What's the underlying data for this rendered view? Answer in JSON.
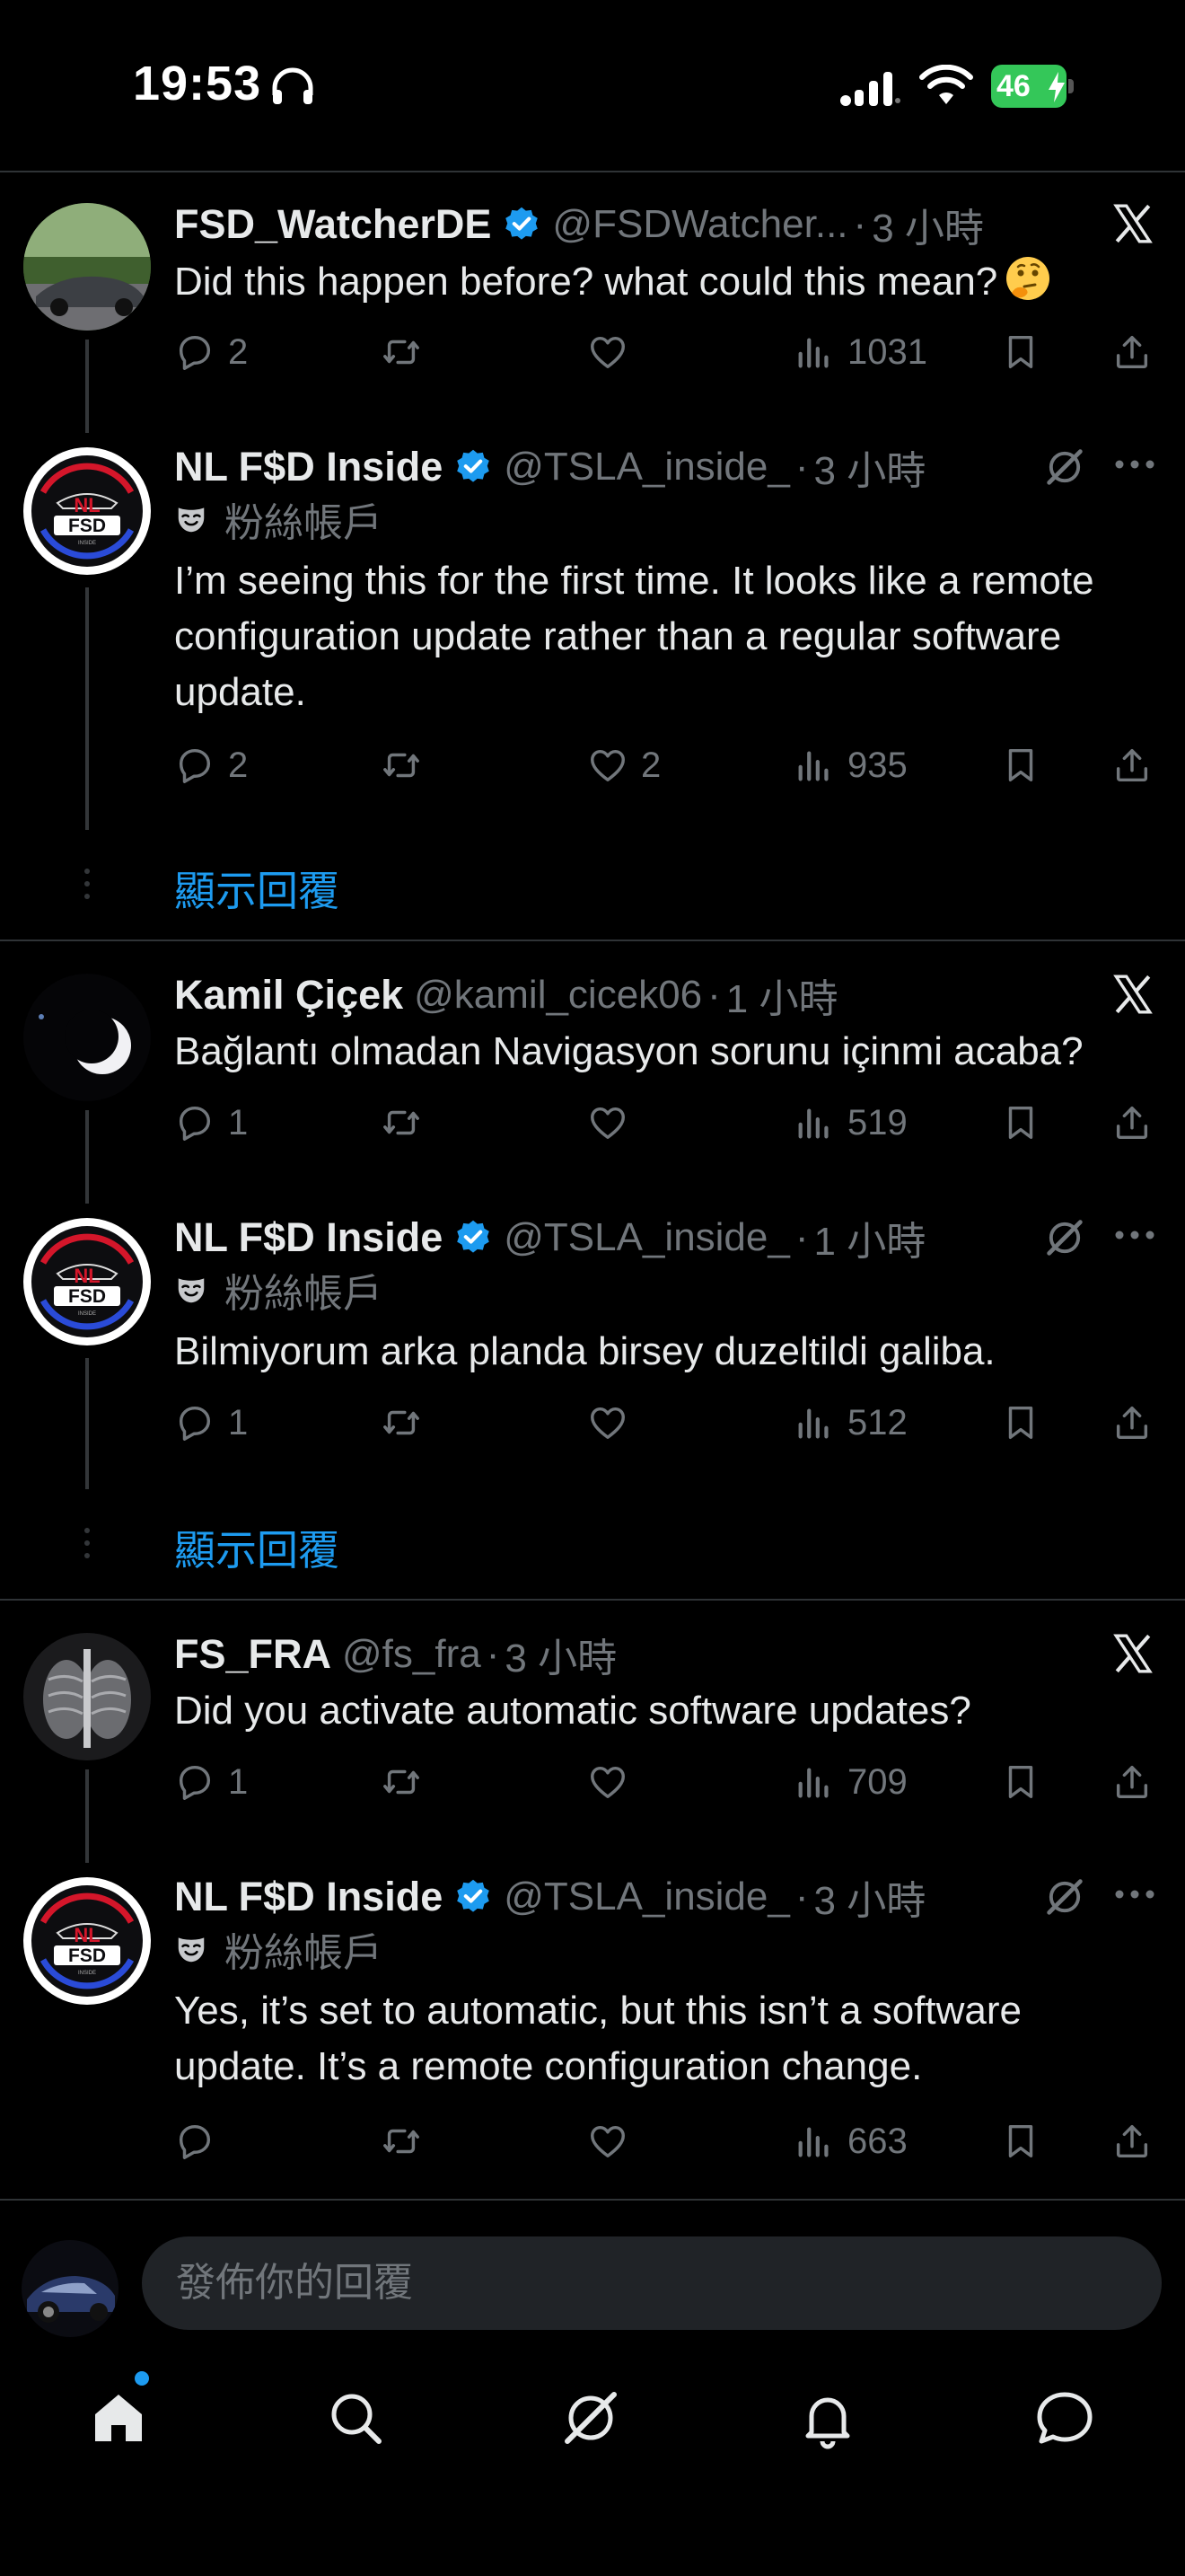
{
  "status_bar": {
    "time": "19:53",
    "battery": "46"
  },
  "tweets": [
    {
      "name": "FSD_WatcherDE",
      "verified": true,
      "handle": "@FSDWatcher...",
      "time": "3 小時",
      "text": "Did this happen before? what could this mean?",
      "emoji": "thinking-face",
      "stats": {
        "replies": "2",
        "retweets": "",
        "likes": "",
        "views": "1031"
      }
    },
    {
      "name": "NL F$D Inside",
      "verified": true,
      "handle": "@TSLA_inside_",
      "time": "3 小時",
      "badge": "粉絲帳戶",
      "text": "I’m seeing this for the first time. It looks like a remote configuration update rather than a regular software update.",
      "stats": {
        "replies": "2",
        "retweets": "",
        "likes": "2",
        "views": "935"
      }
    },
    {
      "name": "Kamil Çiçek",
      "verified": false,
      "handle": "@kamil_cicek06",
      "time": "1 小時",
      "text": "Bağlantı olmadan Navigasyon sorunu içinmi acaba?",
      "stats": {
        "replies": "1",
        "retweets": "",
        "likes": "",
        "views": "519"
      }
    },
    {
      "name": "NL F$D Inside",
      "verified": true,
      "handle": "@TSLA_inside_",
      "time": "1 小時",
      "badge": "粉絲帳戶",
      "text": "Bilmiyorum arka planda birsey duzeltildi galiba.",
      "stats": {
        "replies": "1",
        "retweets": "",
        "likes": "",
        "views": "512"
      }
    },
    {
      "name": "FS_FRA",
      "verified": false,
      "handle": "@fs_fra",
      "time": "3 小時",
      "text": "Did you activate automatic software updates?",
      "stats": {
        "replies": "1",
        "retweets": "",
        "likes": "",
        "views": "709"
      }
    },
    {
      "name": "NL F$D Inside",
      "verified": true,
      "handle": "@TSLA_inside_",
      "time": "3 小時",
      "badge": "粉絲帳戶",
      "text": "Yes, it’s set to automatic, but this isn’t a software update. It’s a remote configuration change.",
      "stats": {
        "replies": "",
        "retweets": "",
        "likes": "",
        "views": "663"
      }
    }
  ],
  "show_replies_label": "顯示回覆",
  "reply_box": {
    "placeholder": "發佈你的回覆"
  },
  "tab_bar": [
    "home-icon",
    "search-icon",
    "grok-icon",
    "notifications-icon",
    "messages-icon"
  ],
  "colors": {
    "background": "#000000",
    "accent": "#1d9bf0",
    "text": "#e7e9ea",
    "muted": "#71767b",
    "divider": "#2f3336",
    "battery": "#34c759"
  }
}
